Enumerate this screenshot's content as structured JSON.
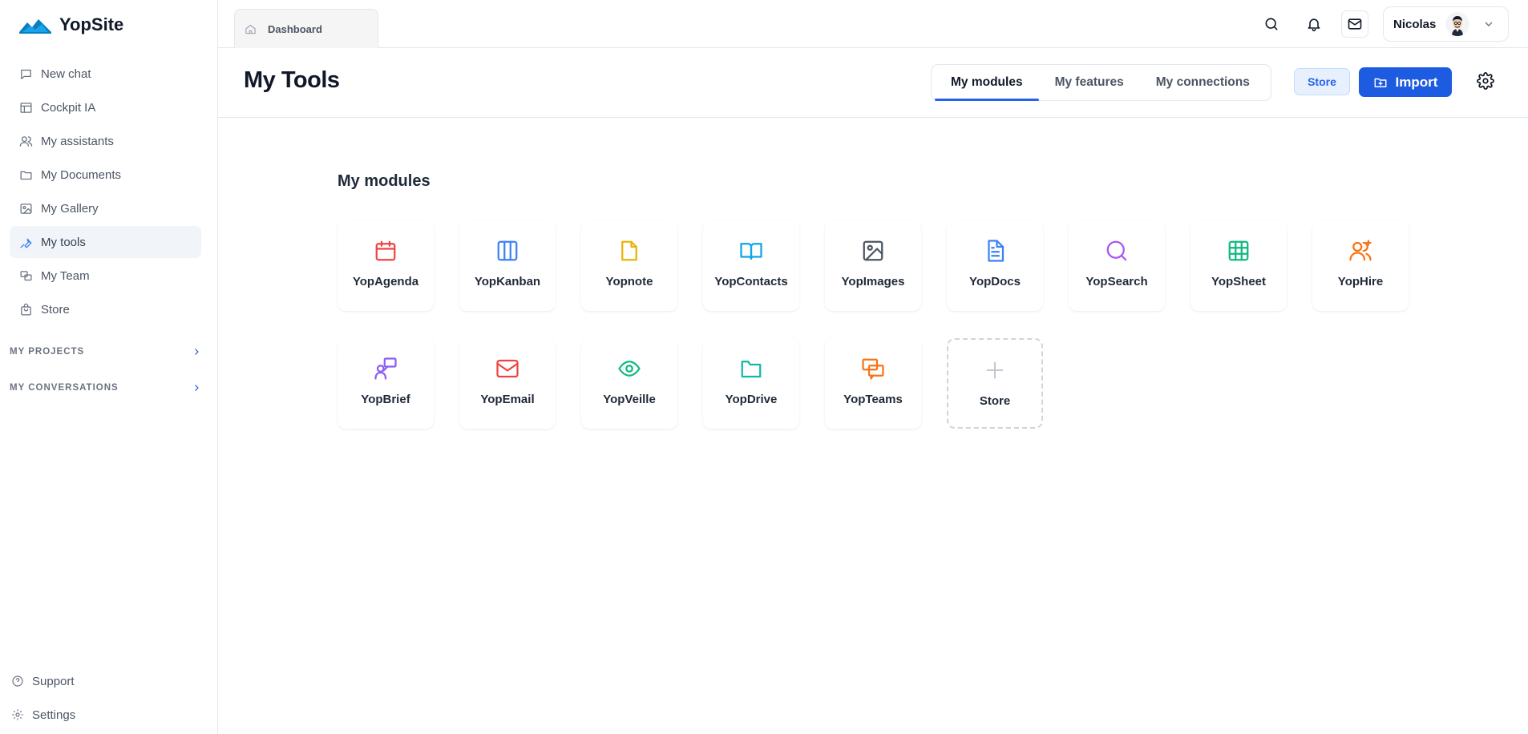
{
  "brand": {
    "name": "YopSite",
    "accent": "#1d5be0",
    "logo_color": "#0a7fbf"
  },
  "sidebar": {
    "items": [
      {
        "label": "New chat",
        "icon": "chat-icon"
      },
      {
        "label": "Cockpit IA",
        "icon": "layout-icon"
      },
      {
        "label": "My assistants",
        "icon": "users-icon"
      },
      {
        "label": "My Documents",
        "icon": "folder-icon"
      },
      {
        "label": "My Gallery",
        "icon": "image-icon"
      },
      {
        "label": "My tools",
        "icon": "wrench-icon",
        "active": true
      },
      {
        "label": "My Team",
        "icon": "team-icon"
      },
      {
        "label": "Store",
        "icon": "bag-icon"
      }
    ],
    "sections": [
      {
        "label": "MY PROJECTS"
      },
      {
        "label": "MY CONVERSATIONS"
      }
    ],
    "bottom": [
      {
        "label": "Support",
        "icon": "help-icon"
      },
      {
        "label": "Settings",
        "icon": "gear-icon"
      }
    ]
  },
  "topbar": {
    "tab_label": "Dashboard",
    "user_name": "Nicolas"
  },
  "header": {
    "title": "My Tools",
    "tabs": [
      {
        "label": "My modules",
        "active": true
      },
      {
        "label": "My features"
      },
      {
        "label": "My connections"
      }
    ],
    "store_label": "Store",
    "import_label": "Import"
  },
  "content": {
    "section_title": "My modules",
    "modules": [
      {
        "label": "YopAgenda",
        "icon": "calendar-icon",
        "color": "#ef4444"
      },
      {
        "label": "YopKanban",
        "icon": "columns-icon",
        "color": "#3b82f6"
      },
      {
        "label": "Yopnote",
        "icon": "note-icon",
        "color": "#eab308"
      },
      {
        "label": "YopContacts",
        "icon": "book-open-icon",
        "color": "#0ea5e9"
      },
      {
        "label": "YopImages",
        "icon": "image-icon",
        "color": "#4b5563"
      },
      {
        "label": "YopDocs",
        "icon": "document-icon",
        "color": "#3b82f6"
      },
      {
        "label": "YopSearch",
        "icon": "search-icon",
        "color": "#a855f7"
      },
      {
        "label": "YopSheet",
        "icon": "table-icon",
        "color": "#10b981"
      },
      {
        "label": "YopHire",
        "icon": "user-plus-icon",
        "color": "#f97316"
      },
      {
        "label": "YopBrief",
        "icon": "presenter-icon",
        "color": "#8b5cf6"
      },
      {
        "label": "YopEmail",
        "icon": "mail-icon",
        "color": "#ef4444"
      },
      {
        "label": "YopVeille",
        "icon": "eye-icon",
        "color": "#10b981"
      },
      {
        "label": "YopDrive",
        "icon": "folder-icon",
        "color": "#14b8a6"
      },
      {
        "label": "YopTeams",
        "icon": "chats-icon",
        "color": "#f97316"
      },
      {
        "label": "Store",
        "icon": "plus-icon",
        "color": "#c4c8cf",
        "dashed": true
      }
    ]
  }
}
